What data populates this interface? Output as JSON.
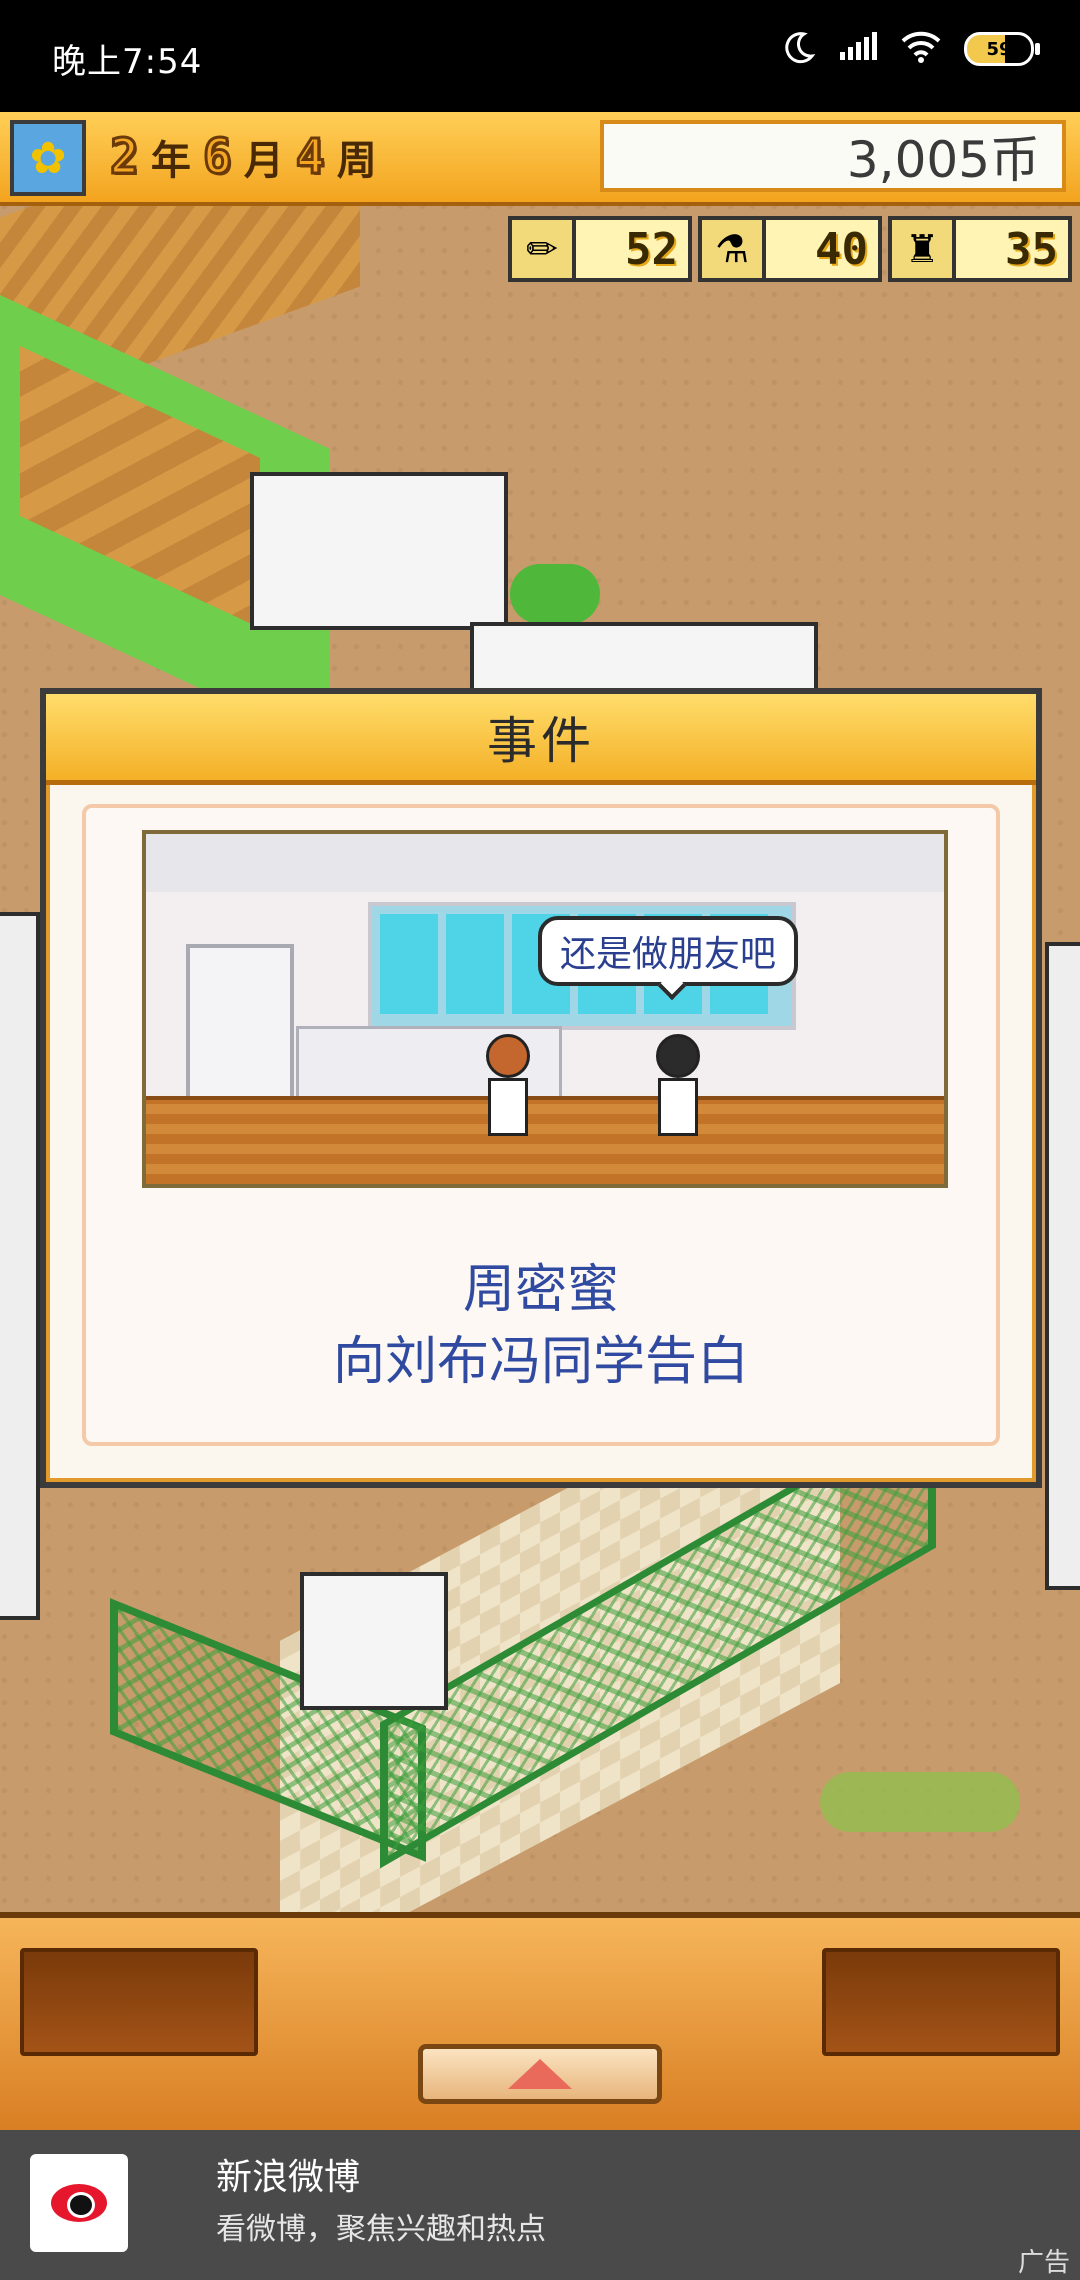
{
  "status_bar": {
    "time": "晚上7:54",
    "battery": "59"
  },
  "header": {
    "year": "2",
    "year_unit": "年",
    "month": "6",
    "month_unit": "月",
    "week": "4",
    "week_unit": "周",
    "money": "3,005币"
  },
  "stats": [
    {
      "icon": "pencil-icon",
      "value": "52"
    },
    {
      "icon": "flask-icon",
      "value": "40"
    },
    {
      "icon": "trophy-icon",
      "value": "35"
    }
  ],
  "dialog": {
    "title": "事件",
    "speech": "还是做朋友吧",
    "line1": "周密蜜",
    "line2": "向刘布冯同学告白"
  },
  "ad": {
    "title": "新浪微博",
    "desc": "看微博，聚焦兴趣和热点",
    "tag": "广告"
  }
}
